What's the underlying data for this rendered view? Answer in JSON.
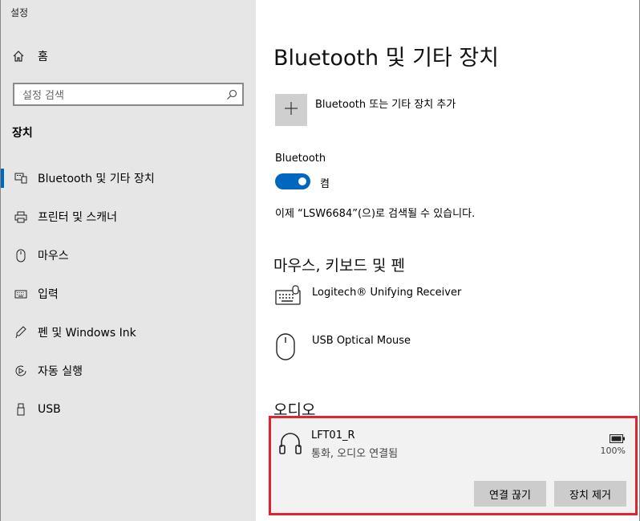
{
  "window": {
    "app_title": "설정"
  },
  "sidebar": {
    "home_label": "홈",
    "search_placeholder": "설정 검색",
    "section_label": "장치",
    "items": [
      {
        "label": "Bluetooth 및 기타 장치",
        "icon": "bluetooth-devices-icon",
        "active": true
      },
      {
        "label": "프린터 및 스캐너",
        "icon": "printer-icon"
      },
      {
        "label": "마우스",
        "icon": "mouse-icon"
      },
      {
        "label": "입력",
        "icon": "keyboard-icon"
      },
      {
        "label": "펜 및 Windows Ink",
        "icon": "pen-icon"
      },
      {
        "label": "자동 실행",
        "icon": "autoplay-icon"
      },
      {
        "label": "USB",
        "icon": "usb-icon"
      }
    ]
  },
  "main": {
    "title": "Bluetooth 및 기타 장치",
    "add_device_label": "Bluetooth 또는 기타 장치 추가",
    "bluetooth_label": "Bluetooth",
    "bluetooth_state": "켬",
    "discoverable_text": "이제 “LSW6684”(으)로 검색될 수 있습니다.",
    "mouse_section": {
      "heading": "마우스, 키보드 및 펜",
      "devices": [
        {
          "name": "Logitech® Unifying Receiver",
          "icon": "keyboard-icon"
        },
        {
          "name": "USB Optical Mouse",
          "icon": "mouse-icon"
        }
      ]
    },
    "audio_section": {
      "heading": "오디오",
      "device": {
        "name": "LFT01_R",
        "status": "통화, 오디오 연결됨",
        "battery_percent": "100%",
        "disconnect_label": "연결 끊기",
        "remove_label": "장치 제거"
      }
    }
  },
  "colors": {
    "accent": "#0067c0",
    "highlight_border": "#e0242f",
    "sidebar_bg": "#e6e6e6"
  }
}
